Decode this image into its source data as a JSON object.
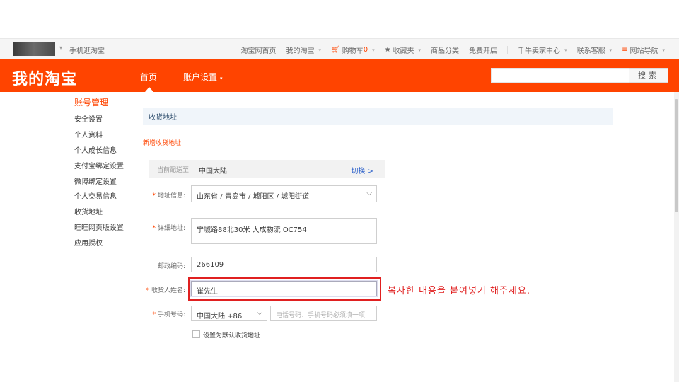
{
  "topbar": {
    "mobile_link": "手机逛淘宝",
    "nav": {
      "home": "淘宝网首页",
      "my_taobao": "我的淘宝",
      "cart": "购物车",
      "cart_count": "0",
      "favorites": "收藏夹",
      "categories": "商品分类",
      "open_shop": "免费开店",
      "seller_center": "千牛卖家中心",
      "service": "联系客服",
      "site_nav": "网站导航"
    },
    "icons": {
      "cart": "cart-icon",
      "star": "star-icon",
      "menu": "menu-icon"
    }
  },
  "header": {
    "logo": "我的淘宝",
    "nav_home": "首页",
    "nav_account": "账户设置",
    "search_button": "搜索",
    "search_value": ""
  },
  "sidebar": {
    "title": "账号管理",
    "items": [
      {
        "label": "安全设置"
      },
      {
        "label": "个人资料"
      },
      {
        "label": "个人成长信息"
      },
      {
        "label": "支付宝绑定设置"
      },
      {
        "label": "微博绑定设置"
      },
      {
        "label": "个人交易信息"
      },
      {
        "label": "收货地址"
      },
      {
        "label": "旺旺网页版设置"
      },
      {
        "label": "应用授权"
      }
    ]
  },
  "main": {
    "section_title": "收货地址",
    "new_address_link": "新增收货地址",
    "region": {
      "label": "当前配送至",
      "value": "中国大陆",
      "switch": "切换 >"
    },
    "form": {
      "address_label": "地址信息:",
      "address_value": "山东省 / 青岛市 / 城阳区 / 城阳街道",
      "detail_label": "详细地址:",
      "detail_value_text": "宁城路88北30米  大成物流 ",
      "detail_value_code": "OC754",
      "postal_label": "邮政编码:",
      "postal_value": "266109",
      "name_label": "收货人姓名:",
      "name_value": "崔先生",
      "phone_label": "手机号码:",
      "phone_country": "中国大陆 +86",
      "phone_placeholder": "电话号码、手机号码必须填一项",
      "default_label": "设置为默认收货地址",
      "required_mark": "*"
    },
    "annotation": "복사한 내용을 붙여넣기 해주세요."
  },
  "colors": {
    "brand": "#ff4400",
    "annotation": "#e02020",
    "link": "#3366cc"
  }
}
